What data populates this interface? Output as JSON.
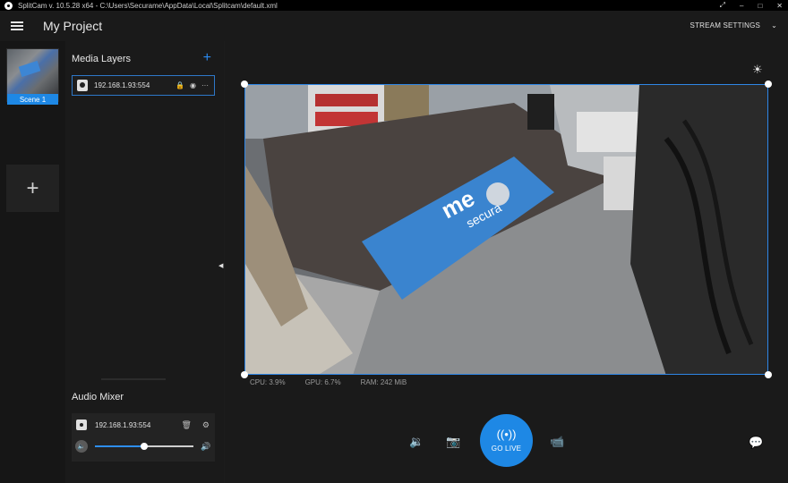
{
  "window": {
    "title": "SplitCam v. 10.5.28 x64 - C:\\Users\\Securame\\AppData\\Local\\Splitcam\\default.xml",
    "controls": {
      "pin": "⤢",
      "minimize": "–",
      "maximize": "□",
      "close": "✕"
    }
  },
  "header": {
    "project_title": "My Project",
    "stream_settings_label": "STREAM SETTINGS",
    "stream_settings_chevron": "⌄"
  },
  "scenes": {
    "items": [
      {
        "label": "Scene 1",
        "selected": true
      }
    ],
    "add_glyph": "+"
  },
  "media_layers": {
    "title": "Media Layers",
    "add_glyph": "+",
    "items": [
      {
        "name": "192.168.1.93:554",
        "lock_glyph": "🔒",
        "eye_glyph": "◉",
        "more_glyph": "···"
      }
    ]
  },
  "audio_mixer": {
    "title": "Audio Mixer",
    "items": [
      {
        "name": "192.168.1.93:554",
        "delete_glyph": "🗑",
        "settings_glyph": "⚙",
        "mute_glyph": "🔈",
        "max_glyph": "🔊",
        "volume": 0.5
      }
    ]
  },
  "preview": {
    "brightness_glyph": "☀",
    "collapse_glyph": "◀",
    "mat_text_line1": "me",
    "mat_text_line2": "secura"
  },
  "stats": {
    "cpu": "CPU: 3.9%",
    "gpu": "GPU: 6.7%",
    "ram": "RAM: 242 MiB"
  },
  "controls": {
    "volume_glyph": "🔉",
    "snapshot_glyph": "📷",
    "go_live_glyph": "((•))",
    "go_live_label": "GO LIVE",
    "record_glyph": "📹",
    "chat_glyph": "💬"
  },
  "colors": {
    "accent": "#1e88e5",
    "selection_border": "#2e86e6",
    "background": "#1a1a1a"
  }
}
